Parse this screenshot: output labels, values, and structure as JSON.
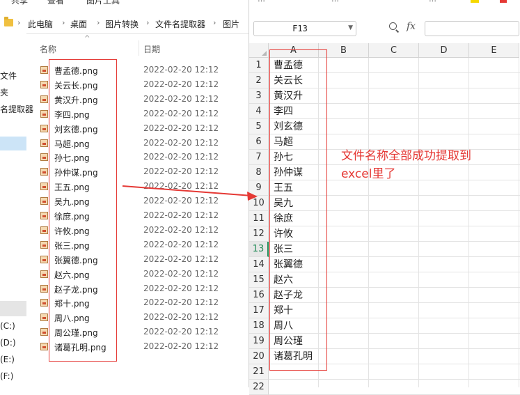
{
  "explorer": {
    "top_tabs": [
      "共享",
      "查看",
      "图片工具"
    ],
    "breadcrumb": [
      "此电脑",
      "桌面",
      "图片转换",
      "文件名提取器",
      "图片"
    ],
    "nav_items": [
      "文件",
      "夹",
      "名提取器",
      "(C:)",
      "(D:)",
      "(E:)",
      "(F:)"
    ],
    "columns": {
      "name": "名称",
      "date": "日期"
    },
    "files": [
      {
        "name": "曹孟德.png",
        "date": "2022-02-20 12:12"
      },
      {
        "name": "关云长.png",
        "date": "2022-02-20 12:12"
      },
      {
        "name": "黄汉升.png",
        "date": "2022-02-20 12:12"
      },
      {
        "name": "李四.png",
        "date": "2022-02-20 12:12"
      },
      {
        "name": "刘玄德.png",
        "date": "2022-02-20 12:12"
      },
      {
        "name": "马超.png",
        "date": "2022-02-20 12:12"
      },
      {
        "name": "孙七.png",
        "date": "2022-02-20 12:12"
      },
      {
        "name": "孙仲谋.png",
        "date": "2022-02-20 12:12"
      },
      {
        "name": "王五.png",
        "date": "2022-02-20 12:12"
      },
      {
        "name": "吴九.png",
        "date": "2022-02-20 12:12"
      },
      {
        "name": "徐庶.png",
        "date": "2022-02-20 12:12"
      },
      {
        "name": "许攸.png",
        "date": "2022-02-20 12:12"
      },
      {
        "name": "张三.png",
        "date": "2022-02-20 12:12"
      },
      {
        "name": "张翼德.png",
        "date": "2022-02-20 12:12"
      },
      {
        "name": "赵六.png",
        "date": "2022-02-20 12:12"
      },
      {
        "name": "赵子龙.png",
        "date": "2022-02-20 12:12"
      },
      {
        "name": "郑十.png",
        "date": "2022-02-20 12:12"
      },
      {
        "name": "周八.png",
        "date": "2022-02-20 12:12"
      },
      {
        "name": "周公瑾.png",
        "date": "2022-02-20 12:12"
      },
      {
        "name": "诸葛孔明.png",
        "date": "2022-02-20 12:12"
      }
    ]
  },
  "spreadsheet": {
    "ribbon_text": [
      "…",
      "…",
      "…"
    ],
    "name_box": "F13",
    "fx_label": "fx",
    "columns": [
      "A",
      "B",
      "C",
      "D",
      "E"
    ],
    "row_numbers": [
      "1",
      "2",
      "3",
      "4",
      "5",
      "6",
      "7",
      "8",
      "9",
      "10",
      "11",
      "12",
      "13",
      "14",
      "15",
      "16",
      "17",
      "18",
      "19",
      "20",
      "21",
      "22"
    ],
    "active_row": "13",
    "column_a": [
      "曹孟德",
      "关云长",
      "黄汉升",
      "李四",
      "刘玄德",
      "马超",
      "孙七",
      "孙仲谋",
      "王五",
      "吴九",
      "徐庶",
      "许攸",
      "张三",
      "张翼德",
      "赵六",
      "赵子龙",
      "郑十",
      "周八",
      "周公瑾",
      "诸葛孔明"
    ]
  },
  "annotation": {
    "text": "文件名称全部成功提取到excel里了",
    "color": "#e53935"
  },
  "colors": {
    "highlight_red": "#e53935",
    "excel_green": "#1f8a55"
  }
}
